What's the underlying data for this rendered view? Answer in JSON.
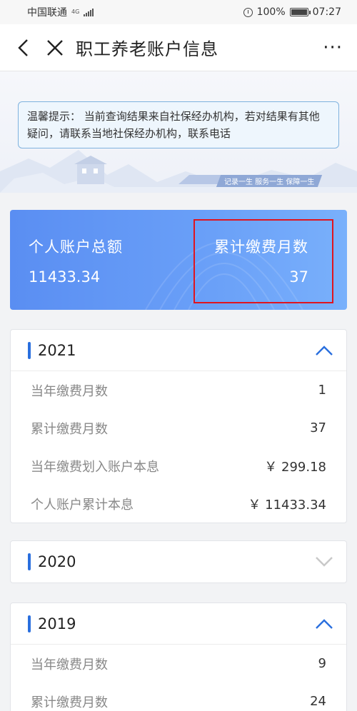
{
  "status_bar": {
    "carrier": "中国联通",
    "network": "4G",
    "battery": "100%",
    "time": "07:27"
  },
  "title_bar": {
    "title": "职工养老账户信息",
    "more": "···"
  },
  "tip": {
    "prefix": "温馨提示：",
    "text": "当前查询结果来自社保经办机构，若对结果有其他疑问，请联系当地社保经办机构，联系电话"
  },
  "slogan": "记录一生 服务一生 保障一生",
  "summary": {
    "total_label": "个人账户总额",
    "total_value": "11433.34",
    "months_label": "累计缴费月数",
    "months_value": "37"
  },
  "years": [
    {
      "year": "2021",
      "expanded": true,
      "rows": [
        {
          "label": "当年缴费月数",
          "value": "1"
        },
        {
          "label": "累计缴费月数",
          "value": "37"
        },
        {
          "label": "当年缴费划入账户本息",
          "value": "￥ 299.18"
        },
        {
          "label": "个人账户累计本息",
          "value": "￥ 11433.34"
        }
      ]
    },
    {
      "year": "2020",
      "expanded": false,
      "rows": []
    },
    {
      "year": "2019",
      "expanded": true,
      "rows": [
        {
          "label": "当年缴费月数",
          "value": "9"
        },
        {
          "label": "累计缴费月数",
          "value": "24"
        }
      ]
    }
  ],
  "colors": {
    "accent": "#2a6fde",
    "card": "#5a8ef2",
    "highlight": "#e0141e"
  }
}
